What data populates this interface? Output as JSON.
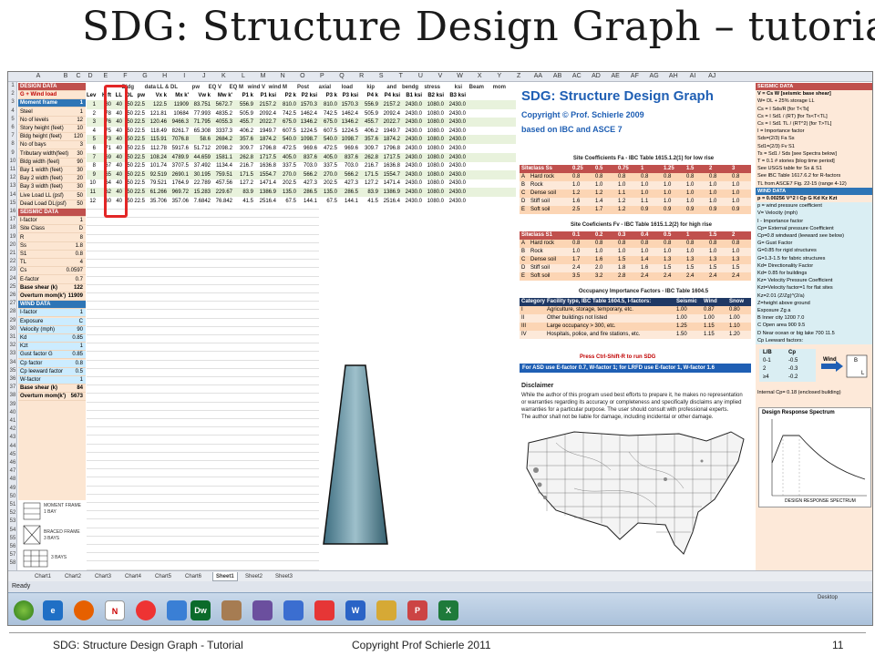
{
  "slide": {
    "title": "SDG: Structure Design Graph – tutorial",
    "footer_left": "SDG: Structure Design Graph - Tutorial",
    "footer_mid": "Copyright Prof Schierle 2011",
    "page_number": "11"
  },
  "columns": [
    "A",
    "B",
    "C",
    "D",
    "E",
    "F",
    "G",
    "H",
    "I",
    "J",
    "K",
    "L",
    "M",
    "N",
    "O",
    "P",
    "Q",
    "R",
    "S",
    "T",
    "U",
    "V",
    "W",
    "X",
    "Y",
    "Z",
    "AA",
    "AB",
    "AC",
    "AD",
    "AE",
    "AF",
    "AG",
    "AH",
    "AI",
    "AJ"
  ],
  "design": {
    "header": "DESIGN DATA",
    "load_label": "G + Wind load",
    "frame_label": "Moment frame",
    "frame_value": "1",
    "rows": [
      {
        "label": "Steel",
        "value": "1"
      },
      {
        "label": "No of levels",
        "value": "12"
      },
      {
        "label": "Story height (feet)",
        "value": "10"
      },
      {
        "label": "Bldg height (feet)",
        "value": "120"
      },
      {
        "label": "No of bays",
        "value": "3"
      },
      {
        "label": "Tributary width(feet)",
        "value": "30"
      },
      {
        "label": "Bldg width (feet)",
        "value": "90"
      },
      {
        "label": "Bay 1 width (feet)",
        "value": "30"
      },
      {
        "label": "Bay 2 width (feet)",
        "value": "20"
      },
      {
        "label": "Bay 3 width (feet)",
        "value": "30"
      },
      {
        "label": "Live Load LL (psf)",
        "value": "50"
      },
      {
        "label": "Dead Load DL(psf)",
        "value": "50"
      }
    ],
    "seismic_header": "SEISMIC DATA",
    "seismic_rows": [
      {
        "label": "I-factor",
        "value": "1"
      },
      {
        "label": "Site Class",
        "value": "D"
      },
      {
        "label": "R",
        "value": "8"
      },
      {
        "label": "Ss",
        "value": "1.8"
      },
      {
        "label": "S1",
        "value": "0.8"
      },
      {
        "label": "TL",
        "value": "4"
      },
      {
        "label": "Cs",
        "value": "0.0597"
      },
      {
        "label": "E-factor",
        "value": "0.7"
      }
    ],
    "base_shear_label": "Base shear (k)",
    "base_shear_value": "122",
    "overturn_label": "Overturn mom(k')",
    "overturn_value": "11909",
    "wind_header": "WIND DATA",
    "wind_rows": [
      {
        "label": "I-factor",
        "value": "1"
      },
      {
        "label": "Exposure",
        "value": "C"
      },
      {
        "label": "Velocity (mph)",
        "value": "90"
      },
      {
        "label": "Kd",
        "value": "0.85"
      },
      {
        "label": "Kzt",
        "value": "1"
      },
      {
        "label": "Gust factor G",
        "value": "0.85"
      },
      {
        "label": "Cp factor",
        "value": "0.8"
      },
      {
        "label": "Cp leeward factor",
        "value": "0.5"
      },
      {
        "label": "W-factor",
        "value": "1"
      }
    ],
    "wind_base_shear_value": "84",
    "wind_overturn_value": "5673",
    "sketch_labels": [
      "MOMENT FRAME",
      "1 BAY",
      "BRACED FRAME",
      "3 BAYS",
      "3 BAYS"
    ]
  },
  "table": {
    "headers": [
      "Lev",
      "H ft",
      "LL",
      "DL",
      "pw",
      "Vx k",
      "Mx k'",
      "Vw k",
      "Mw k'",
      "P1 k",
      "P1 ksi",
      "P2 k",
      "P2 ksi",
      "P3 k",
      "P3 ksi",
      "P4 k",
      "P4 ksi",
      "B1 ksi",
      "B2 ksi",
      "B3 ksi"
    ],
    "top_headers": [
      "Bldg",
      "data",
      "LL & DL",
      "pw",
      "EQ V",
      "EQ M",
      "wind V",
      "wind M",
      "Post",
      "axial",
      "load",
      "kip",
      "and",
      "bendg",
      "stress",
      "ksi",
      "Beam",
      "mom",
      "ksi"
    ],
    "rows": [
      [
        "1",
        "80",
        "40",
        "50",
        "22.5",
        "122.5",
        "11909",
        "83.751",
        "5672.7",
        "556.9",
        "2157.2",
        "810.0",
        "1570.3",
        "810.0",
        "1570.3",
        "556.9",
        "2157.2",
        "2430.0",
        "1080.0",
        "2430.0"
      ],
      [
        "2",
        "78",
        "40",
        "50",
        "22.5",
        "121.81",
        "10684",
        "77.993",
        "4835.2",
        "505.9",
        "2092.4",
        "742.5",
        "1462.4",
        "742.5",
        "1462.4",
        "505.9",
        "2092.4",
        "2430.0",
        "1080.0",
        "2430.0"
      ],
      [
        "3",
        "76",
        "40",
        "50",
        "22.5",
        "120.46",
        "9466.3",
        "71.795",
        "4055.3",
        "455.7",
        "2022.7",
        "675.0",
        "1346.2",
        "675.0",
        "1346.2",
        "455.7",
        "2022.7",
        "2430.0",
        "1080.0",
        "2430.0"
      ],
      [
        "4",
        "75",
        "40",
        "50",
        "22.5",
        "118.49",
        "8261.7",
        "65.308",
        "3337.3",
        "406.2",
        "1949.7",
        "607.5",
        "1224.5",
        "607.5",
        "1224.5",
        "406.2",
        "1949.7",
        "2430.0",
        "1080.0",
        "2430.0"
      ],
      [
        "5",
        "73",
        "40",
        "50",
        "22.5",
        "115.91",
        "7076.8",
        "58.6",
        "2684.2",
        "357.6",
        "1874.2",
        "540.0",
        "1098.7",
        "540.0",
        "1098.7",
        "357.6",
        "1874.2",
        "2430.0",
        "1080.0",
        "2430.0"
      ],
      [
        "6",
        "71",
        "40",
        "50",
        "22.5",
        "112.78",
        "5917.6",
        "51.712",
        "2098.2",
        "309.7",
        "1796.8",
        "472.5",
        "969.6",
        "472.5",
        "969.6",
        "309.7",
        "1796.8",
        "2430.0",
        "1080.0",
        "2430.0"
      ],
      [
        "7",
        "69",
        "40",
        "50",
        "22.5",
        "108.24",
        "4789.9",
        "44.659",
        "1581.1",
        "262.8",
        "1717.5",
        "405.0",
        "837.6",
        "405.0",
        "837.6",
        "262.8",
        "1717.5",
        "2430.0",
        "1080.0",
        "2430.0"
      ],
      [
        "8",
        "67",
        "40",
        "50",
        "22.5",
        "101.74",
        "3707.5",
        "37.492",
        "1134.4",
        "216.7",
        "1636.8",
        "337.5",
        "703.0",
        "337.5",
        "703.0",
        "216.7",
        "1636.8",
        "2430.0",
        "1080.0",
        "2430.0"
      ],
      [
        "9",
        "65",
        "40",
        "50",
        "22.5",
        "92.519",
        "2690.1",
        "30.195",
        "759.51",
        "171.5",
        "1554.7",
        "270.0",
        "566.2",
        "270.0",
        "566.2",
        "171.5",
        "1554.7",
        "2430.0",
        "1080.0",
        "2430.0"
      ],
      [
        "10",
        "64",
        "40",
        "50",
        "22.5",
        "79.521",
        "1764.9",
        "22.789",
        "457.56",
        "127.2",
        "1471.4",
        "202.5",
        "427.3",
        "202.5",
        "427.3",
        "127.2",
        "1471.4",
        "2430.0",
        "1080.0",
        "2430.0"
      ],
      [
        "11",
        "62",
        "40",
        "50",
        "22.5",
        "61.266",
        "969.72",
        "15.283",
        "229.67",
        "83.9",
        "1386.9",
        "135.0",
        "286.5",
        "135.0",
        "286.5",
        "83.9",
        "1386.9",
        "2430.0",
        "1080.0",
        "2430.0"
      ],
      [
        "12",
        "60",
        "40",
        "50",
        "22.5",
        "35.706",
        "357.06",
        "7.6842",
        "76.842",
        "41.5",
        "2516.4",
        "67.5",
        "144.1",
        "67.5",
        "144.1",
        "41.5",
        "2516.4",
        "2430.0",
        "1080.0",
        "2430.0"
      ]
    ]
  },
  "panel": {
    "title": "SDG: Structure Design Graph",
    "copyright": "Copyright  ©  Prof. Schierle 2009",
    "based_on": "based on IBC and ASCE 7",
    "fa_title": "Site Coefficients Fa - IBC Table 1615.1.2(1) for low rise",
    "fa_header": [
      "Site",
      "class Ss",
      "0.25",
      "0.5",
      "0.75",
      "1",
      "1.25",
      "1.5",
      "2",
      "3"
    ],
    "fa_rows": [
      [
        "A",
        "Hard rock",
        "0.8",
        "0.8",
        "0.8",
        "0.8",
        "0.8",
        "0.8",
        "0.8",
        "0.8"
      ],
      [
        "B",
        "Rock",
        "1.0",
        "1.0",
        "1.0",
        "1.0",
        "1.0",
        "1.0",
        "1.0",
        "1.0"
      ],
      [
        "C",
        "Dense soil",
        "1.2",
        "1.2",
        "1.1",
        "1.0",
        "1.0",
        "1.0",
        "1.0",
        "1.0"
      ],
      [
        "D",
        "Stiff soil",
        "1.6",
        "1.4",
        "1.2",
        "1.1",
        "1.0",
        "1.0",
        "1.0",
        "1.0"
      ],
      [
        "E",
        "Soft soil",
        "2.5",
        "1.7",
        "1.2",
        "0.9",
        "0.9",
        "0.9",
        "0.9",
        "0.9"
      ]
    ],
    "fv_title": "Site Coeficients Fv - IBC Table 1615.1.2(2) for high rise",
    "fv_header": [
      "Site",
      "class S1",
      "0.1",
      "0.2",
      "0.3",
      "0.4",
      "0.5",
      "1",
      "1.5",
      "2"
    ],
    "fv_rows": [
      [
        "A",
        "Hard rock",
        "0.8",
        "0.8",
        "0.8",
        "0.8",
        "0.8",
        "0.8",
        "0.8",
        "0.8"
      ],
      [
        "B",
        "Rock",
        "1.0",
        "1.0",
        "1.0",
        "1.0",
        "1.0",
        "1.0",
        "1.0",
        "1.0"
      ],
      [
        "C",
        "Dense soil",
        "1.7",
        "1.6",
        "1.5",
        "1.4",
        "1.3",
        "1.3",
        "1.3",
        "1.3"
      ],
      [
        "D",
        "Stiff soil",
        "2.4",
        "2.0",
        "1.8",
        "1.6",
        "1.5",
        "1.5",
        "1.5",
        "1.5"
      ],
      [
        "E",
        "Soft soil",
        "3.5",
        "3.2",
        "2.8",
        "2.4",
        "2.4",
        "2.4",
        "2.4",
        "2.4"
      ]
    ],
    "occ_title": "Occupancy Importance Factors - IBC Table 1604.5",
    "occ_header": [
      "Category",
      "Facility type, IBC Table 1604.5, I-factors:",
      "Seismic",
      "Wind",
      "Snow"
    ],
    "occ_rows": [
      [
        "I",
        "Agriculture, storage, temporary, etc.",
        "1.00",
        "0.87",
        "0.80"
      ],
      [
        "II",
        "Other buildings not listed",
        "1.00",
        "1.00",
        "1.00"
      ],
      [
        "III",
        "Large occupancy > 300, etc.",
        "1.25",
        "1.15",
        "1.10"
      ],
      [
        "IV",
        "Hospitals, police, and fire stations, etc.",
        "1.50",
        "1.15",
        "1.20"
      ]
    ],
    "run_text": "Press Ctrl-Shift-R to run SDG",
    "lrfd_text": "For ASD use E-factor 0.7, W-factor 1; for LRFD use E-factor 1, W-factor 1.6",
    "disclaimer_title": "Disclaimer",
    "disclaimer_lines": [
      "While the author of this program used best efforts to prepare it, he makes no representation",
      "or warranties regarding its accuracy or completeness and specifically disclaims any implied",
      "warranties for a particular purpose. The user should consult with professional experts.",
      "The author shall not be liable for damage, including incidental or other damage."
    ]
  },
  "seismic": {
    "rows": [
      {
        "t": "SEISMIC DATA",
        "k": "sec"
      },
      {
        "t": "V = Cs W     [seismic base shear]",
        "k": "bold"
      },
      {
        "t": "W= DL + 25% storage LL",
        "k": ""
      },
      {
        "t": "Cs = I Sds/R          [for T<Ts]",
        "k": ""
      },
      {
        "t": "Cs = I Sd1 / (RT)       [for Ts<T<TL]",
        "k": ""
      },
      {
        "t": "Cs = I Sd1 TL / (RT^2)   [for T>TL]",
        "k": ""
      },
      {
        "t": "I = Importance factor",
        "k": ""
      },
      {
        "t": "Sds=(2/3) Fa Ss",
        "k": ""
      },
      {
        "t": "Sd1=(2/3) Fv S1",
        "k": ""
      },
      {
        "t": "Ts = Sd1 / Sds  [see Spectra below]",
        "k": ""
      },
      {
        "t": "T = 0.1 # stories  [blog time period]",
        "k": ""
      },
      {
        "t": "See USGS table for Ss & S1",
        "k": ""
      },
      {
        "t": "See IBC Table 1617.6.2 for R-factors",
        "k": ""
      },
      {
        "t": "TL from ASCE7 Fig. 22-15 (range 4-12)",
        "k": ""
      },
      {
        "t": "WIND DATA",
        "k": "blu"
      },
      {
        "t": "p = 0.00256 V^2 I Cp G Kd Kz Kzt",
        "k": "bold"
      },
      {
        "t": "p = wind pressure coefficient",
        "k": "wind"
      },
      {
        "t": "V= Velocity (mph)",
        "k": "wind"
      },
      {
        "t": "I - Importance factor",
        "k": "wind"
      },
      {
        "t": "Cp= External pressure Coefficient",
        "k": "wind"
      },
      {
        "t": "Cp=0.8 windward (leeward see below)",
        "k": "wind"
      },
      {
        "t": "G= Gust Factor",
        "k": "wind"
      },
      {
        "t": "G=0.85 for rigid structures",
        "k": "wind"
      },
      {
        "t": "G=1.3-1.5 for fabric structures",
        "k": "wind"
      },
      {
        "t": "Kd= Directionality Factor",
        "k": "wind"
      },
      {
        "t": "Kd= 0.85 for buildings",
        "k": "wind"
      },
      {
        "t": "Kz= Velocity Pressure Coefficient",
        "k": "wind"
      },
      {
        "t": "Kzt=Velocity factor=1 for flat sites",
        "k": "wind"
      },
      {
        "t": "Kz=2.01 (Z/Zg)^(2/a)",
        "k": "wind"
      },
      {
        "t": "Z=height above ground",
        "k": "wind"
      },
      {
        "t": "Exposure              Zg        a",
        "k": "wind"
      },
      {
        "t": "B  Inner city            1200    7.0",
        "k": "wind"
      },
      {
        "t": "C  Open area              900     9.5",
        "k": "wind"
      },
      {
        "t": "D  Near ocean or big lake   700   11.5",
        "k": "wind"
      },
      {
        "t": "Cp   Leeward factors:",
        "k": "wind"
      }
    ],
    "cp_rows": [
      [
        "L/B",
        "Cp"
      ],
      [
        "0-1",
        "-0.5"
      ],
      [
        "2",
        "-0.3"
      ],
      [
        "≥4",
        "-0.2"
      ]
    ],
    "wind_label": "Wind",
    "b_label": "B",
    "l_label": "L",
    "internal_cp": "Internal Cp= 0.18 (enclosed building)",
    "spectrum_title": "Design Response Spectrum",
    "spectrum_caption": "DESIGN RESPONSE SPECTRUM"
  },
  "tabs": [
    "Chart1",
    "Chart2",
    "Chart3",
    "Chart4",
    "Chart5",
    "Chart6",
    "Sheet1",
    "Sheet2",
    "Sheet3"
  ],
  "active_tab": "Sheet1",
  "status": "Ready",
  "taskbar": {
    "desktop_label": "Desktop"
  }
}
